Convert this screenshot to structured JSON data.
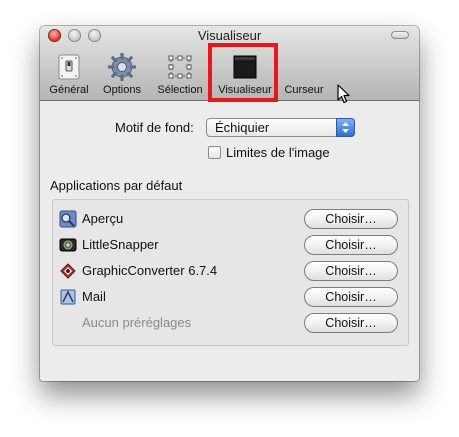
{
  "window": {
    "title": "Visualiseur"
  },
  "toolbar": {
    "tabs": [
      {
        "label": "Général",
        "icon": "general-switch-icon"
      },
      {
        "label": "Options",
        "icon": "gear-icon"
      },
      {
        "label": "Sélection",
        "icon": "selection-icon"
      },
      {
        "label": "Visualiseur",
        "icon": "black-square-icon",
        "selected": true
      },
      {
        "label": "Curseur",
        "icon": "pointer-icon"
      }
    ],
    "highlight_color": "#e6171e"
  },
  "settings": {
    "background_label": "Motif de fond:",
    "background_value": "Échiquier",
    "image_bounds_label": "Limites de l'image",
    "image_bounds_checked": false
  },
  "default_apps": {
    "heading": "Applications par défaut",
    "apps": [
      {
        "name": "Aperçu",
        "icon": "preview-app-icon",
        "button": "Choisir…"
      },
      {
        "name": "LittleSnapper",
        "icon": "littlesnapper-app-icon",
        "button": "Choisir…"
      },
      {
        "name": "GraphicConverter 6.7.4",
        "icon": "graphicconverter-app-icon",
        "button": "Choisir…"
      },
      {
        "name": "Mail",
        "icon": "mail-app-icon",
        "button": "Choisir…"
      },
      {
        "name": "Aucun préréglages",
        "icon": "",
        "button": "Choisir…",
        "dimmed": true
      }
    ]
  }
}
